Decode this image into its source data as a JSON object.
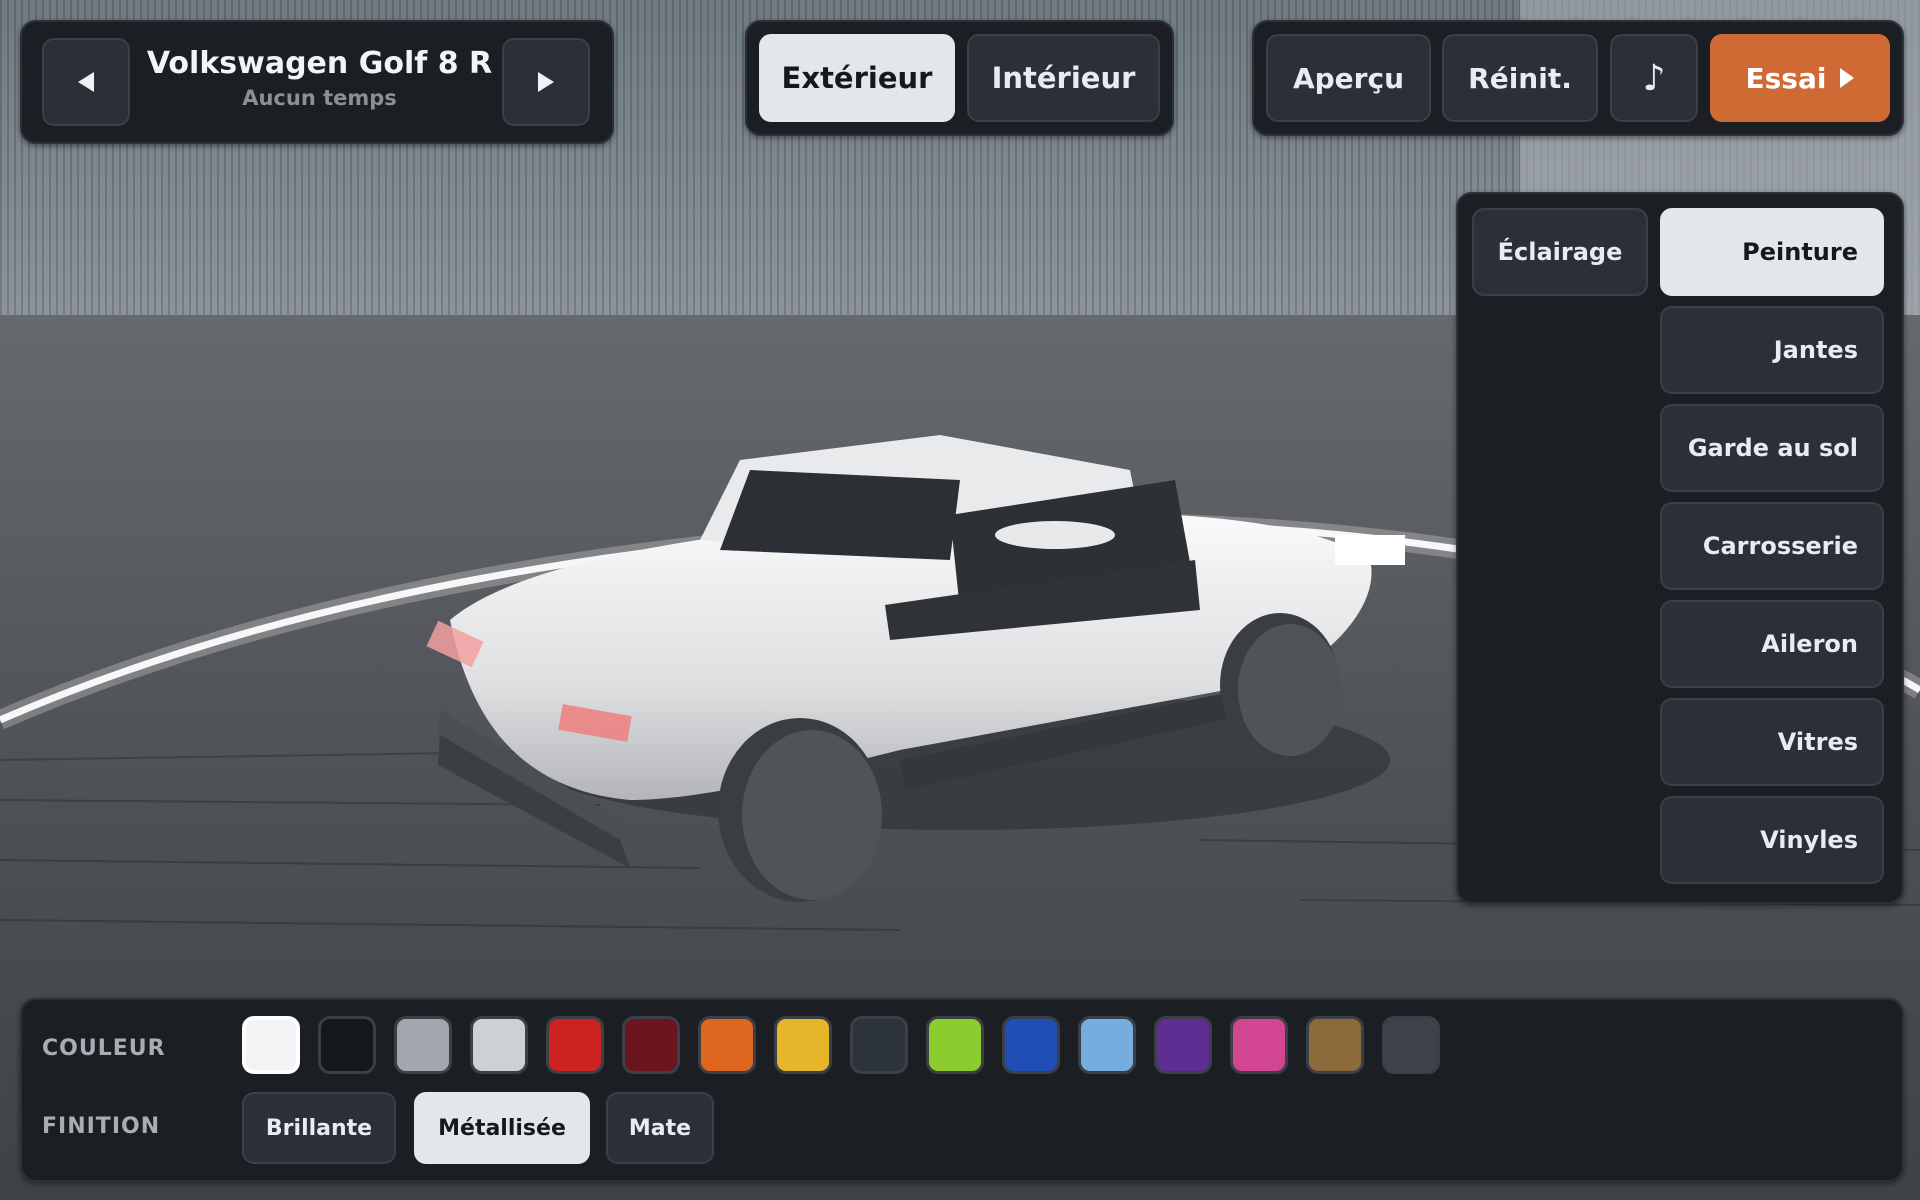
{
  "header": {
    "car_name": "Volkswagen Golf 8 R",
    "car_subtitle": "Aucun temps"
  },
  "view_tabs": [
    {
      "label": "Extérieur",
      "active": true
    },
    {
      "label": "Intérieur",
      "active": false
    }
  ],
  "actions": {
    "preview": "Aperçu",
    "reset": "Réinit.",
    "music_icon": "♪",
    "test_drive": "Essai"
  },
  "menu": {
    "lighting": "Éclairage",
    "items": [
      {
        "label": "Peinture",
        "active": true
      },
      {
        "label": "Jantes",
        "active": false
      },
      {
        "label": "Garde au sol",
        "active": false
      },
      {
        "label": "Carrosserie",
        "active": false
      },
      {
        "label": "Aileron",
        "active": false
      },
      {
        "label": "Vitres",
        "active": false
      },
      {
        "label": "Vinyles",
        "active": false
      }
    ]
  },
  "paint": {
    "color_label": "COULEUR",
    "finish_label": "FINITION",
    "swatches": [
      "#f2f3f5",
      "#15181c",
      "#a3a7ad",
      "#cdd0d4",
      "#cc2222",
      "#6b1520",
      "#df661e",
      "#e5b62a",
      "#2c333b",
      "#8ccc2f",
      "#1f4fb5",
      "#75aede",
      "#5e2e94",
      "#d24591",
      "#8c6a3c",
      "#3e4349"
    ],
    "selected_swatch": 0,
    "finishes": [
      {
        "label": "Brillante",
        "active": false
      },
      {
        "label": "Métallisée",
        "active": true
      },
      {
        "label": "Mate",
        "active": false
      }
    ]
  }
}
